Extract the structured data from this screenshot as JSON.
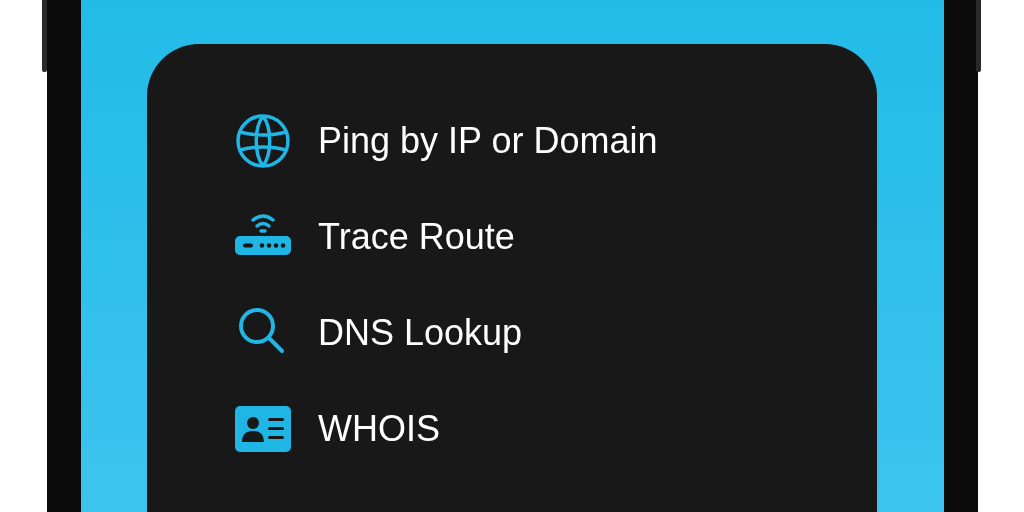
{
  "menu": {
    "items": [
      {
        "kind": "globe",
        "label": "Ping by IP or Domain"
      },
      {
        "kind": "router",
        "label": "Trace Route"
      },
      {
        "kind": "search",
        "label": "DNS Lookup"
      },
      {
        "kind": "idcard",
        "label": "WHOIS"
      }
    ]
  }
}
